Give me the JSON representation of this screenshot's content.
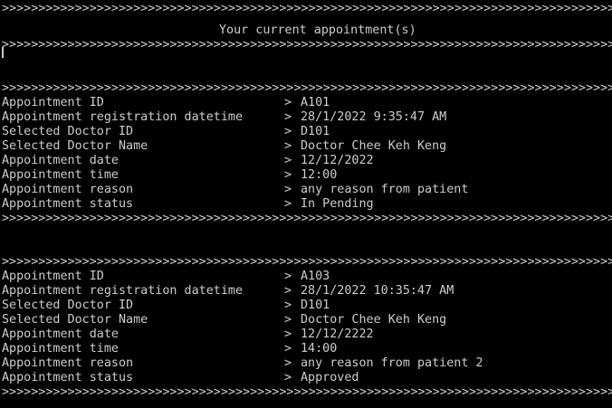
{
  "window": {
    "background": "#000000",
    "text_color": "#cccccc"
  },
  "header": {
    "separator_top": ">>>>>>>>>>>>>>>>>>>>>>>>>>>>>>>>>>>>>>>>>>>>>>>>>>>>>>>>>>>>>>>>>>>>>>>>>>>>>>>>>>>>>>>>>>>>>>>>>>>",
    "title": "Your current appointment(s)",
    "separator_bottom": ">>>>>>>>>>>>>>>>>>>>>>>>>>>>>>>>>>>>>>>>>>>>>>>>>>>>>>>>>>>>>>>>>>>>>>>>>>>>>>>>>>>>>>>>>>>>>>>>>>>"
  },
  "separator": ">>>>>>>>>>>>>>>>>>>>>>>>>>>>>>>>>>>>>>>>>>>>>>>>>>>>>>>>>>>>>>>>>>>>>>>>>>>>>>>>>>>>>>>>>>>>>>>>>>>",
  "arrow": ">",
  "appointments": [
    {
      "fields": [
        {
          "label": "Appointment ID",
          "value": "A101"
        },
        {
          "label": "Appointment registration datetime",
          "value": "28/1/2022 9:35:47 AM"
        },
        {
          "label": "Selected Doctor ID",
          "value": "D101"
        },
        {
          "label": "Selected Doctor Name",
          "value": "Doctor Chee Keh Keng"
        },
        {
          "label": "Appointment date",
          "value": "12/12/2022"
        },
        {
          "label": "Appointment time",
          "value": "12:00"
        },
        {
          "label": "Appointment reason",
          "value": "any reason from patient"
        },
        {
          "label": "Appointment status",
          "value": "In Pending"
        }
      ]
    },
    {
      "fields": [
        {
          "label": "Appointment ID",
          "value": "A103"
        },
        {
          "label": "Appointment registration datetime",
          "value": "28/1/2022 10:35:47 AM"
        },
        {
          "label": "Selected Doctor ID",
          "value": "D101"
        },
        {
          "label": "Selected Doctor Name",
          "value": "Doctor Chee Keh Keng"
        },
        {
          "label": "Appointment date",
          "value": "12/12/2222"
        },
        {
          "label": "Appointment time",
          "value": "14:00"
        },
        {
          "label": "Appointment reason",
          "value": "any reason from patient 2"
        },
        {
          "label": "Appointment status",
          "value": "Approved"
        }
      ]
    }
  ]
}
